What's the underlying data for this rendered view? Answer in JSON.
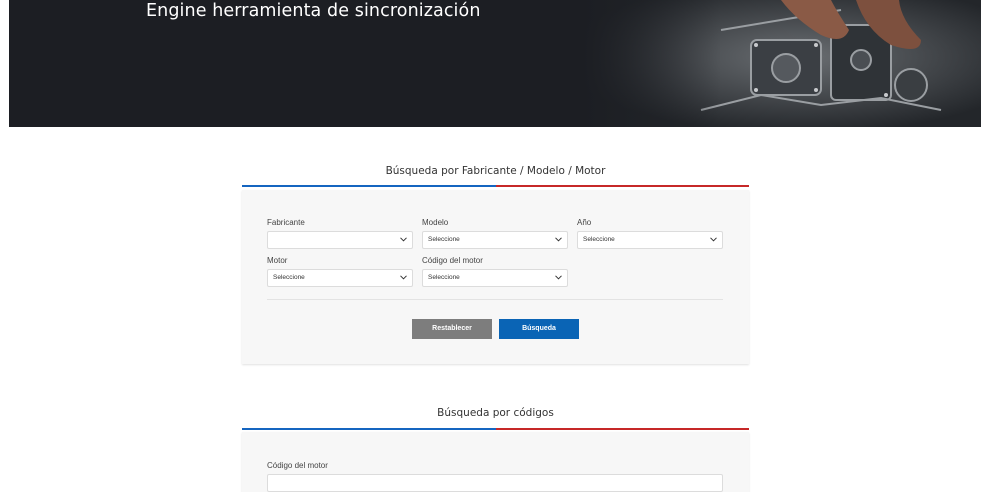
{
  "hero": {
    "title": "Engine herramienta de sincronización"
  },
  "brand_colors": {
    "blue": "#1565c0",
    "red": "#c62828",
    "search_button": "#0a64b5",
    "reset_button": "#7d7d7d"
  },
  "section_model": {
    "title": "Búsqueda por Fabricante / Modelo / Motor",
    "fields": {
      "fabricante": {
        "label": "Fabricante",
        "value": ""
      },
      "modelo": {
        "label": "Modelo",
        "value": "Seleccione"
      },
      "anio": {
        "label": "Año",
        "value": "Seleccione"
      },
      "motor": {
        "label": "Motor",
        "value": "Seleccione"
      },
      "codigo_motor": {
        "label": "Código del motor",
        "value": "Seleccione"
      }
    },
    "reset_label": "Restablecer",
    "search_label": "Búsqueda"
  },
  "section_codes": {
    "title": "Búsqueda por códigos",
    "field_label": "Código del motor",
    "field_value": ""
  },
  "icons": {
    "dropdown": "chevron-down-icon"
  }
}
